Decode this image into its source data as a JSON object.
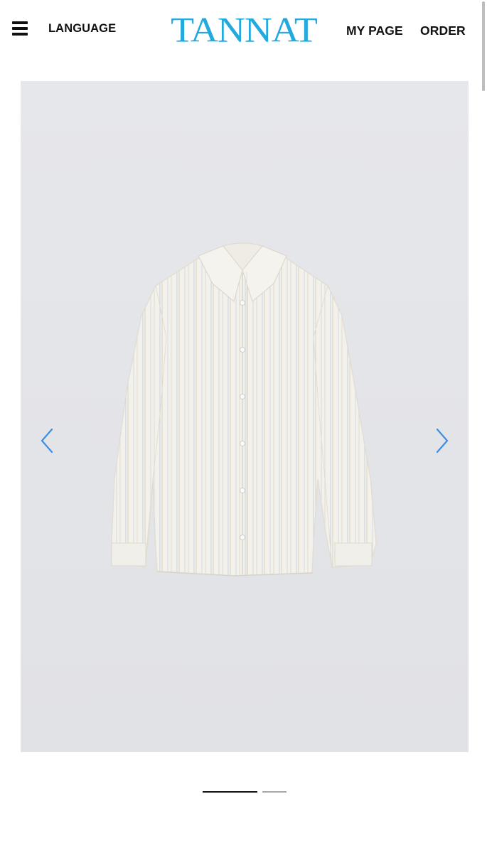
{
  "header": {
    "menu_icon": "hamburger-menu-icon",
    "language_label": "LANGUAGE",
    "logo_text": "TANNAT",
    "my_page_label": "MY PAGE",
    "order_label": "ORDER"
  },
  "colors": {
    "brand": "#22a9de",
    "arrow": "#3a8ee6",
    "image_background": "#e4e5e9"
  },
  "carousel": {
    "prev_icon": "chevron-left-icon",
    "next_icon": "chevron-right-icon",
    "image_subject": "white striped long-sleeve shirt",
    "slide_count": 2,
    "active_slide": 1
  }
}
